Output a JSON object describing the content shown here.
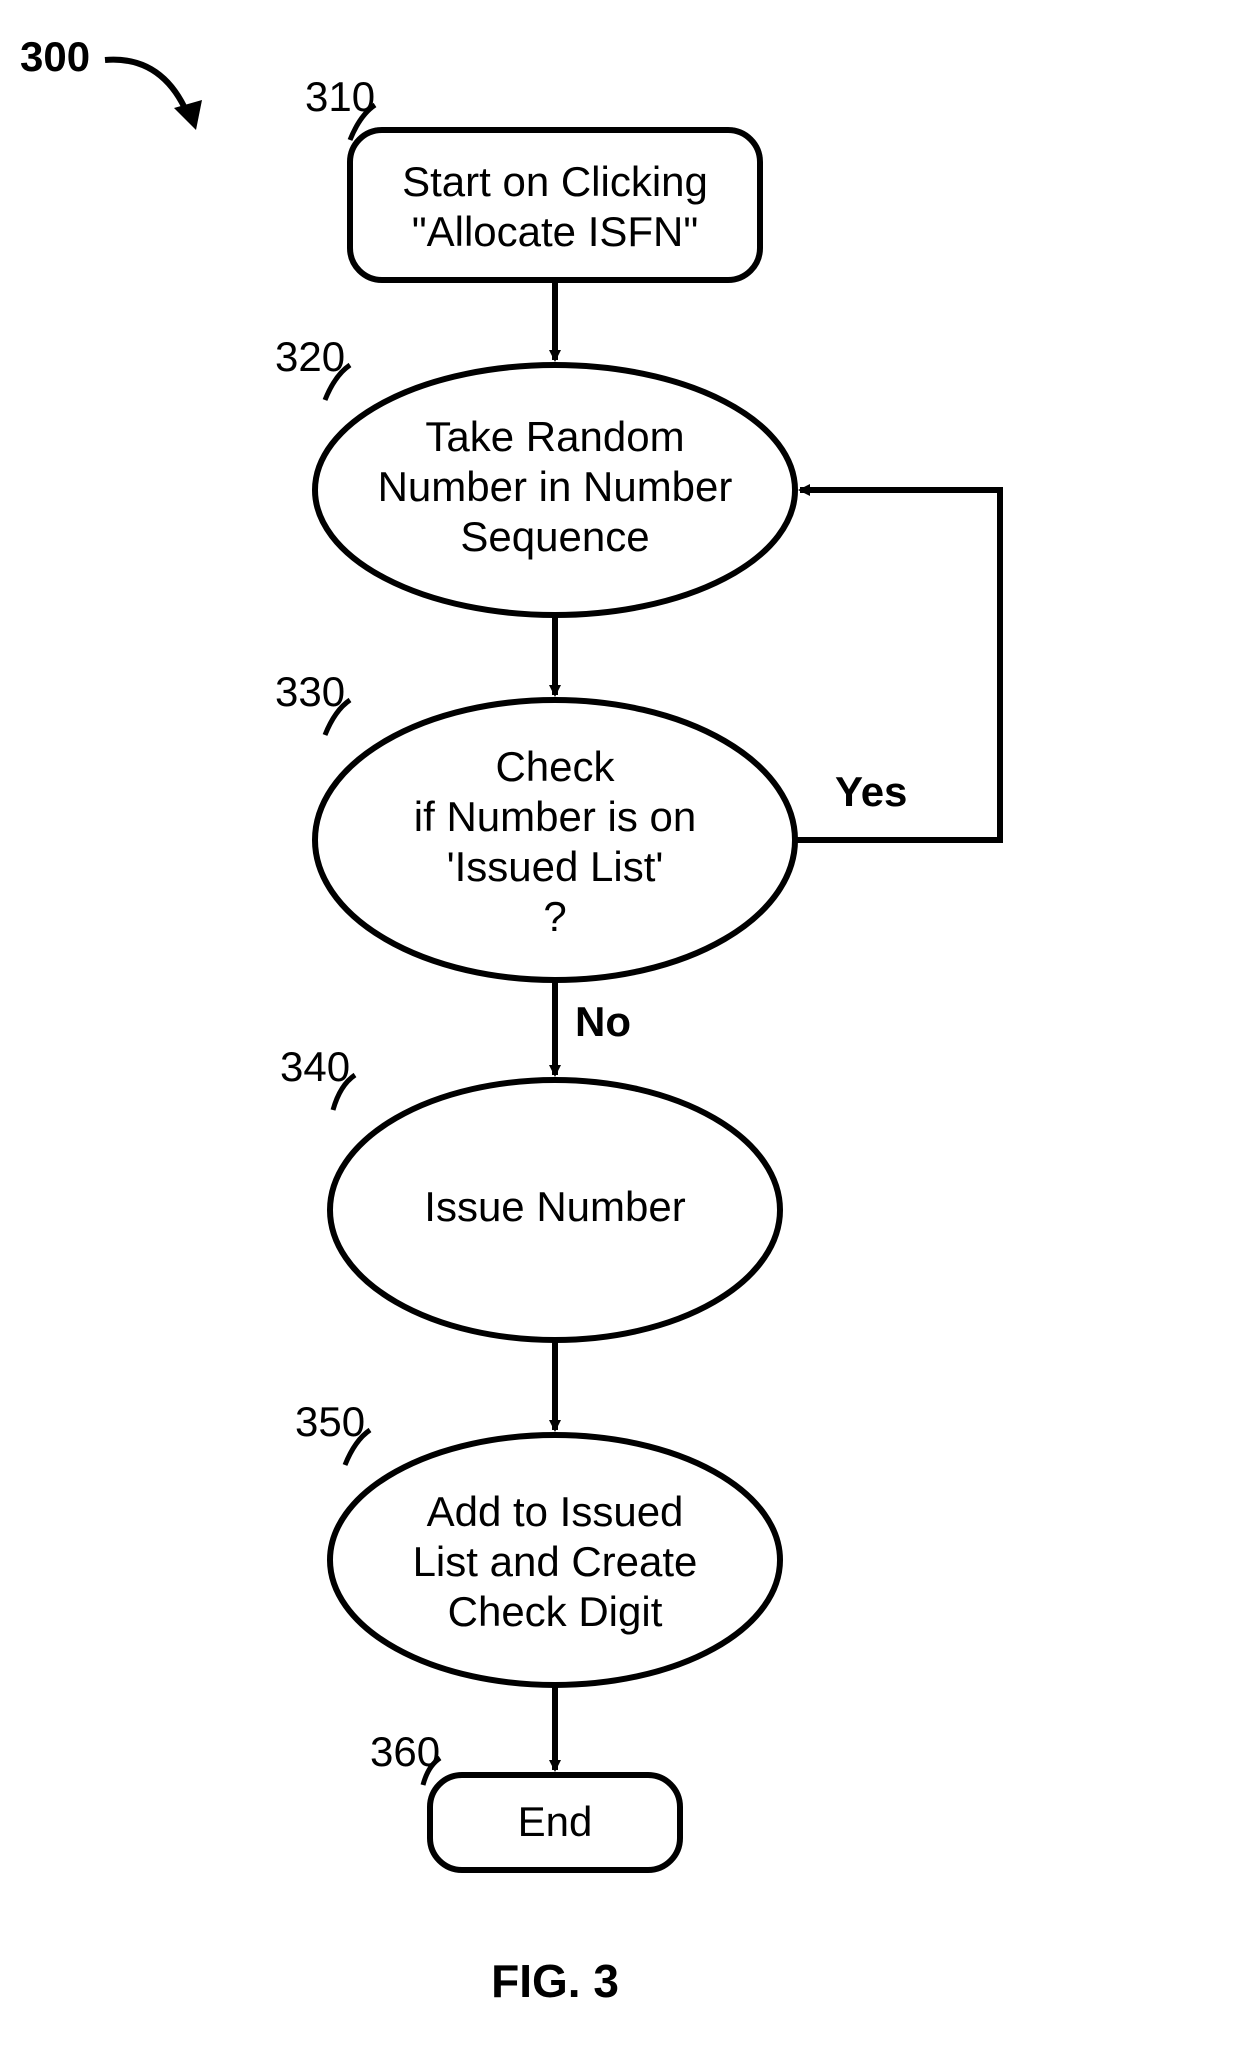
{
  "figure_ref": "300",
  "caption": "FIG. 3",
  "nodes": {
    "n310": {
      "ref": "310",
      "lines": [
        "Start on Clicking",
        "\"Allocate ISFN\""
      ]
    },
    "n320": {
      "ref": "320",
      "lines": [
        "Take Random",
        "Number in Number",
        "Sequence"
      ]
    },
    "n330": {
      "ref": "330",
      "lines": [
        "Check",
        "if Number is on",
        "'Issued List'",
        "?"
      ]
    },
    "n340": {
      "ref": "340",
      "lines": [
        "Issue Number"
      ]
    },
    "n350": {
      "ref": "350",
      "lines": [
        "Add to Issued",
        "List and Create",
        "Check Digit"
      ]
    },
    "n360": {
      "ref": "360",
      "lines": [
        "End"
      ]
    }
  },
  "edges": {
    "yes": "Yes",
    "no": "No"
  }
}
